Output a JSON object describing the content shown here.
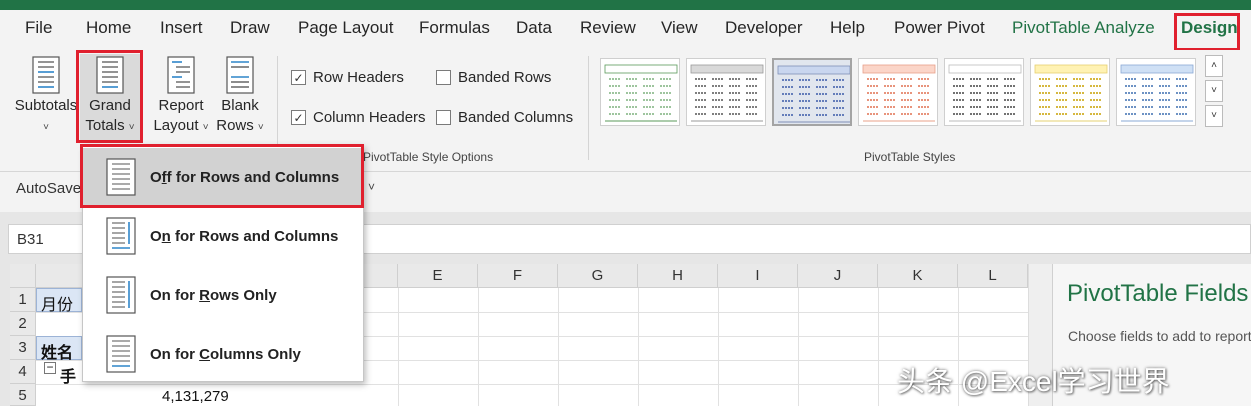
{
  "tabs": [
    "File",
    "Home",
    "Insert",
    "Draw",
    "Page Layout",
    "Formulas",
    "Data",
    "Review",
    "View",
    "Developer",
    "Help",
    "Power Pivot",
    "PivotTable Analyze",
    "Design"
  ],
  "layout_group": {
    "subtotals": "Subtotals",
    "grand_totals_1": "Grand",
    "grand_totals_2": "Totals",
    "report_layout_1": "Report",
    "report_layout_2": "Layout",
    "blank_rows_1": "Blank",
    "blank_rows_2": "Rows"
  },
  "style_options": {
    "row_headers": "Row Headers",
    "column_headers": "Column Headers",
    "banded_rows": "Banded Rows",
    "banded_columns": "Banded Columns",
    "group_label": "PivotTable Style Options",
    "row_headers_checked": true,
    "column_headers_checked": true,
    "banded_rows_checked": false,
    "banded_columns_checked": false
  },
  "styles": {
    "group_label": "PivotTable Styles"
  },
  "qat": {
    "autosave": "AutoSave"
  },
  "namebox": {
    "value": "B31"
  },
  "sheet": {
    "columns": [
      "E",
      "F",
      "G",
      "H",
      "I",
      "J",
      "K",
      "L"
    ],
    "rows": [
      "1",
      "2",
      "3",
      "4",
      "5"
    ],
    "cell_a1": "月份",
    "cell_a3": "姓名",
    "cell_a4": "手",
    "cell_b5": "4,131,279"
  },
  "pane": {
    "title": "PivotTable Fields",
    "subtitle": "Choose fields to add to report:"
  },
  "menu": {
    "items": [
      {
        "pre": "O",
        "acc": "f",
        "post": "f for Rows and Columns"
      },
      {
        "pre": "O",
        "acc": "n",
        "post": " for Rows and Columns"
      },
      {
        "pre": "On for ",
        "acc": "R",
        "post": "ows Only"
      },
      {
        "pre": "On for ",
        "acc": "C",
        "post": "olumns Only"
      }
    ]
  },
  "watermark": "头条 @Excel学习世界",
  "colors": {
    "accent": "#217346",
    "highlight": "#e0202e"
  }
}
